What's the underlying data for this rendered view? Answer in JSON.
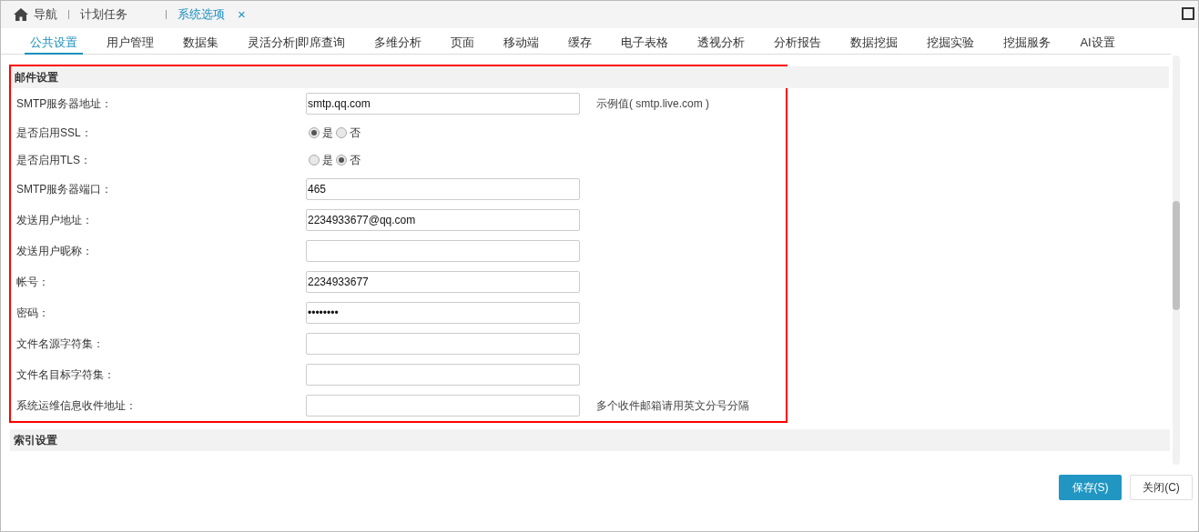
{
  "nav_tabs": [
    {
      "label": "导航",
      "selected": false
    },
    {
      "label": "计划任务",
      "selected": false
    },
    {
      "label": "系统选项",
      "selected": true,
      "close_label": "×"
    }
  ],
  "tabs": [
    {
      "label": "公共设置",
      "selected": true
    },
    {
      "label": "用户管理",
      "selected": false
    },
    {
      "label": "数据集",
      "selected": false
    },
    {
      "label": "灵活分析|即席查询",
      "selected": false
    },
    {
      "label": "多维分析",
      "selected": false
    },
    {
      "label": "页面",
      "selected": false
    },
    {
      "label": "移动端",
      "selected": false
    },
    {
      "label": "缓存",
      "selected": false
    },
    {
      "label": "电子表格",
      "selected": false
    },
    {
      "label": "透视分析",
      "selected": false
    },
    {
      "label": "分析报告",
      "selected": false
    },
    {
      "label": "数据挖掘",
      "selected": false
    },
    {
      "label": "挖掘实验",
      "selected": false
    },
    {
      "label": "挖掘服务",
      "selected": false
    },
    {
      "label": "AI设置",
      "selected": false
    }
  ],
  "sections": [
    {
      "title": "邮件设置",
      "highlighted": true,
      "fields": [
        {
          "kind": "text",
          "label": "SMTP服务器地址：",
          "value": "smtp.qq.com",
          "hint": "示例值( smtp.live.com )"
        },
        {
          "kind": "radio",
          "label": "是否启用SSL：",
          "options": [
            {
              "label": "是",
              "selected": true
            },
            {
              "label": "否",
              "selected": false
            }
          ]
        },
        {
          "kind": "radio",
          "label": "是否启用TLS：",
          "options": [
            {
              "label": "是",
              "selected": false
            },
            {
              "label": "否",
              "selected": true
            }
          ]
        },
        {
          "kind": "text",
          "label": "SMTP服务器端口：",
          "value": "465"
        },
        {
          "kind": "text",
          "label": "发送用户地址：",
          "value": "2234933677@qq.com"
        },
        {
          "kind": "text",
          "label": "发送用户昵称："
        },
        {
          "kind": "text",
          "label": "帐号：",
          "value": "2234933677"
        },
        {
          "kind": "text",
          "label": "密码：",
          "value": "••••••••"
        },
        {
          "kind": "text",
          "label": "文件名源字符集："
        },
        {
          "kind": "text",
          "label": "文件名目标字符集："
        },
        {
          "kind": "text",
          "label": "系统运维信息收件地址：",
          "hint": "多个收件邮箱请用英文分号分隔"
        }
      ]
    },
    {
      "title": "索引设置",
      "highlighted": false
    }
  ],
  "buttons": [
    {
      "label": "保存(S)",
      "kind": "primary"
    },
    {
      "label": "关闭(C)",
      "kind": "default"
    }
  ]
}
